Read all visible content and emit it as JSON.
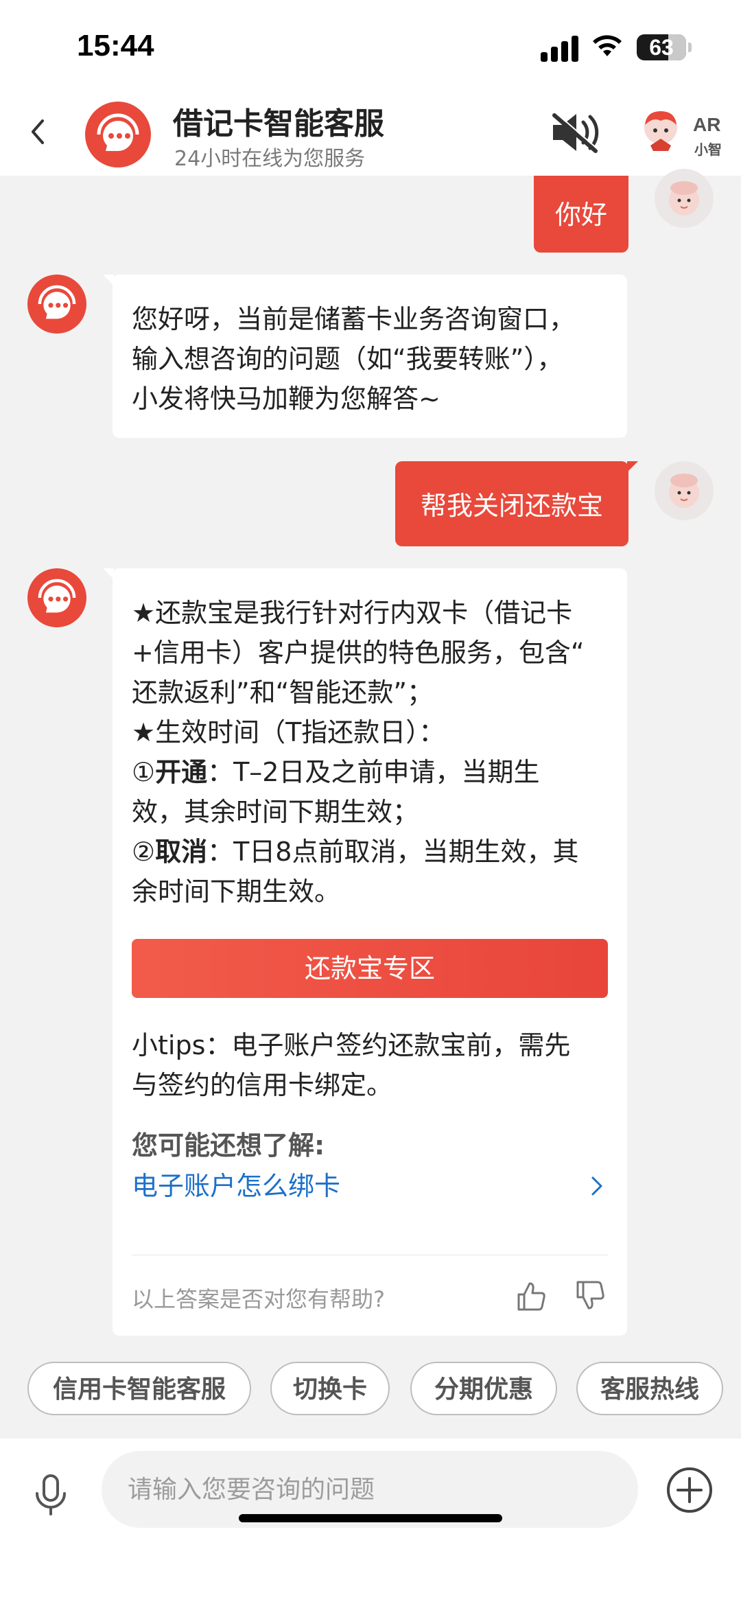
{
  "status_bar": {
    "time": "15:44",
    "battery": "63"
  },
  "header": {
    "title": "借记卡智能客服",
    "subtitle": "24小时在线为您服务",
    "ar_label": "AR",
    "ar_sub": "小智"
  },
  "messages": {
    "user_1": "你好",
    "bot_1": {
      "line1": "您好呀，当前是储蓄卡业务咨询窗口，",
      "line2": "输入想咨询的问题（如“我要转账”），",
      "line3": "小发将快马加鞭为您解答~"
    },
    "user_2": "帮我关闭还款宝",
    "bot_2": {
      "l1": "★还款宝是我行针对行内双卡（借记卡",
      "l2": "+信用卡）客户提供的特色服务，包含“",
      "l3": "还款返利”和“智能还款”；",
      "l4": "★生效时间（T指还款日）：",
      "l5_prefix": "①",
      "l5_bold": "开通",
      "l5_rest": "：T–2日及之前申请，当期生",
      "l6": "效，其余时间下期生效；",
      "l7_prefix": "②",
      "l7_bold": "取消",
      "l7_rest": "：T日8点前取消，当期生效，其",
      "l8": "余时间下期生效。",
      "cta_label": "还款宝专区",
      "tips_line1": "小tips：电子账户签约还款宝前，需先",
      "tips_line2": "与签约的信用卡绑定。",
      "related_title": "您可能还想了解:",
      "related_link": "电子账户怎么绑卡",
      "feedback": "以上答案是否对您有帮助?"
    }
  },
  "quick_chips": [
    "信用卡智能客服",
    "切换卡",
    "分期优惠",
    "客服热线"
  ],
  "input": {
    "placeholder": "请输入您要咨询的问题"
  },
  "colors": {
    "brand": "#e8493b",
    "link": "#1d70c8"
  }
}
